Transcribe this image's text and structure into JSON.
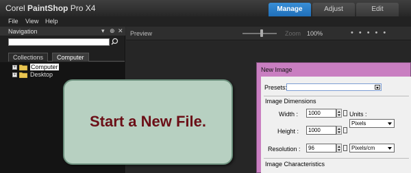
{
  "app": {
    "title_brand": "Corel",
    "title_product": "PaintShop",
    "title_suffix": "Pro X4"
  },
  "mode_tabs": [
    {
      "label": "Manage",
      "active": true
    },
    {
      "label": "Adjust",
      "active": false
    },
    {
      "label": "Edit",
      "active": false
    }
  ],
  "menu": [
    {
      "label": "File"
    },
    {
      "label": "View"
    },
    {
      "label": "Help"
    }
  ],
  "navigation": {
    "title": "Navigation",
    "controls": [
      "▾",
      "⊕",
      "✕"
    ],
    "search_value": "",
    "tabs": [
      {
        "label": "Collections",
        "active": false
      },
      {
        "label": "Computer",
        "active": true
      }
    ],
    "tree": [
      {
        "label": "Computer",
        "selected": true
      },
      {
        "label": "Desktop",
        "selected": false
      }
    ]
  },
  "preview": {
    "title": "Preview",
    "zoom_label": "Zoom",
    "zoom_value": "100%",
    "view_dots": "•••••"
  },
  "callout": {
    "text": "Start a New File."
  },
  "new_image_dialog": {
    "title": "New Image",
    "presets_label": "Presets:",
    "presets_value": "",
    "group_dimensions": "Image Dimensions",
    "width_label": "Width :",
    "width_value": "1000",
    "height_label": "Height :",
    "height_value": "1000",
    "units_label": "Units :",
    "units_value": "Pixels",
    "resolution_label": "Resolution :",
    "resolution_value": "96",
    "resolution_units": "Pixels/cm",
    "group_characteristics": "Image Characteristics"
  },
  "colors": {
    "accent_tab": "#2a7fcc",
    "dialog_frame": "#c97ec1",
    "callout_fill": "#b7d0c1",
    "callout_text": "#6b0f17"
  }
}
